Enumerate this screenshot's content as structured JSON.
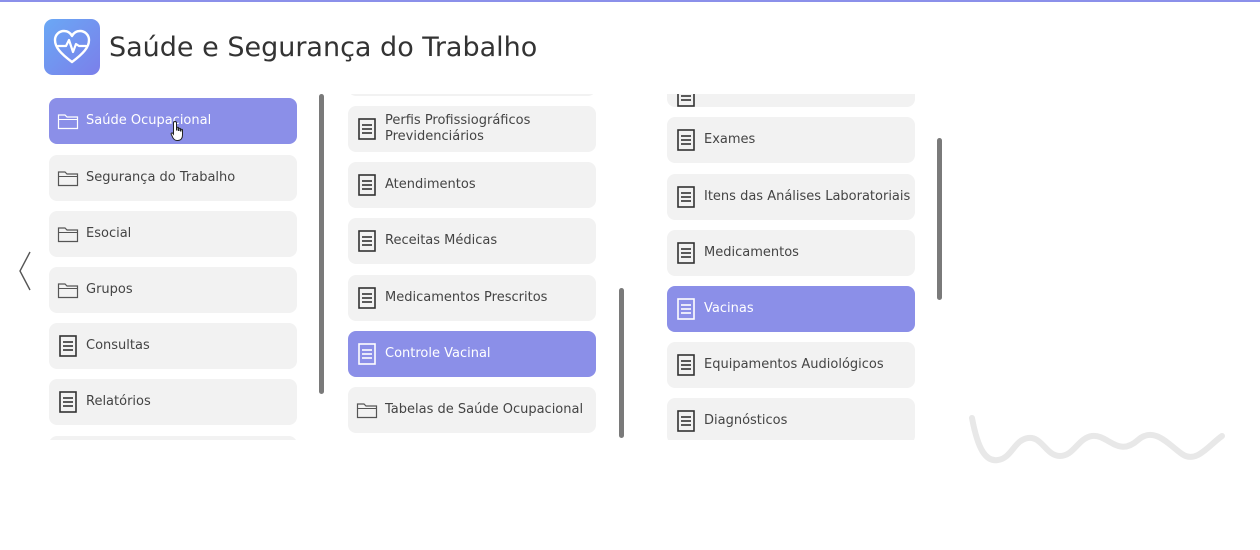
{
  "app": {
    "title": "Saúde e Segurança do Trabalho",
    "accent_color": "#8b8fe8",
    "logo_icon": "heart-pulse-icon"
  },
  "columns": [
    {
      "items": [
        {
          "label": "Saúde Ocupacional",
          "icon": "folder-icon",
          "active": true
        },
        {
          "label": "Segurança do Trabalho",
          "icon": "folder-icon",
          "active": false
        },
        {
          "label": "Esocial",
          "icon": "folder-icon",
          "active": false
        },
        {
          "label": "Grupos",
          "icon": "folder-icon",
          "active": false
        },
        {
          "label": "Consultas",
          "icon": "document-icon",
          "active": false
        },
        {
          "label": "Relatórios",
          "icon": "document-icon",
          "active": false
        }
      ]
    },
    {
      "items": [
        {
          "label": "Perfis Profissiográficos Previdenciários",
          "icon": "document-icon",
          "active": false
        },
        {
          "label": "Atendimentos",
          "icon": "document-icon",
          "active": false
        },
        {
          "label": "Receitas Médicas",
          "icon": "document-icon",
          "active": false
        },
        {
          "label": "Medicamentos Prescritos",
          "icon": "document-icon",
          "active": false
        },
        {
          "label": "Controle Vacinal",
          "icon": "document-icon",
          "active": true
        },
        {
          "label": "Tabelas de Saúde Ocupacional",
          "icon": "folder-icon",
          "active": false
        }
      ]
    },
    {
      "items": [
        {
          "label": "Exames",
          "icon": "document-icon",
          "active": false
        },
        {
          "label": "Itens das Análises Laboratoriais",
          "icon": "document-icon",
          "active": false
        },
        {
          "label": "Medicamentos",
          "icon": "document-icon",
          "active": false
        },
        {
          "label": "Vacinas",
          "icon": "document-icon",
          "active": true
        },
        {
          "label": "Equipamentos Audiológicos",
          "icon": "document-icon",
          "active": false
        },
        {
          "label": "Diagnósticos",
          "icon": "document-icon",
          "active": false
        }
      ]
    }
  ]
}
